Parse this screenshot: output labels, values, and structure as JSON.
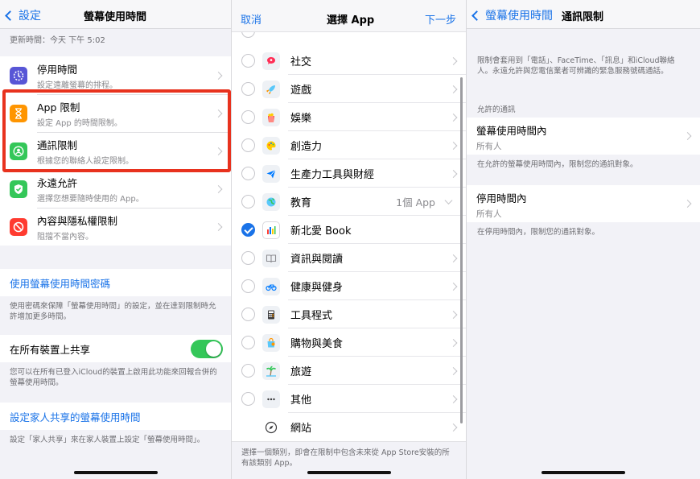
{
  "panel1": {
    "back_label": "設定",
    "title": "螢幕使用時間",
    "updated": "更新時間：今天 下午 5:02",
    "items": [
      {
        "title": "停用時間",
        "subtitle": "設定遠離螢幕的排程。",
        "icon": "downtime-icon",
        "color": "#5856d6"
      },
      {
        "title": "App 限制",
        "subtitle": "設定 App 的時間限制。",
        "icon": "hourglass-icon",
        "color": "#ff9500"
      },
      {
        "title": "通訊限制",
        "subtitle": "根據您的聯絡人設定限制。",
        "icon": "contact-icon",
        "color": "#34c759"
      },
      {
        "title": "永遠允許",
        "subtitle": "選擇您想要隨時使用的 App。",
        "icon": "checkmark-shield-icon",
        "color": "#34c759"
      },
      {
        "title": "內容與隱私權限制",
        "subtitle": "阻擋不當內容。",
        "icon": "restriction-icon",
        "color": "#ff3b30"
      }
    ],
    "passcode_link": "使用螢幕使用時間密碼",
    "passcode_note": "使用密碼來保障「螢幕使用時間」的設定，並在達到限制時允許增加更多時間。",
    "share_label": "在所有裝置上共享",
    "share_on": true,
    "share_note": "您可以在所有已登入iCloud的裝置上啟用此功能來回報合併的螢幕使用時間。",
    "family_link": "設定家人共享的螢幕使用時間",
    "family_note": "設定「家人共享」來在家人裝置上設定「螢幕使用時間」。"
  },
  "panel2": {
    "cancel_label": "取消",
    "title": "選擇 App",
    "next_label": "下一步",
    "categories": [
      {
        "label": "社交",
        "checked": false,
        "icon": "social-icon",
        "color": "#ff2d55"
      },
      {
        "label": "遊戲",
        "checked": false,
        "icon": "rocket-icon",
        "color": "#5ac8fa"
      },
      {
        "label": "娛樂",
        "checked": false,
        "icon": "popcorn-icon",
        "color": "#ff3b30"
      },
      {
        "label": "創造力",
        "checked": false,
        "icon": "palette-icon",
        "color": "#ffcc00"
      },
      {
        "label": "生產力工具與財經",
        "checked": false,
        "icon": "paperplane-icon",
        "color": "#007aff"
      },
      {
        "label": "教育",
        "checked": false,
        "icon": "globe-icon",
        "color": "#34c759",
        "count": "1個 App",
        "expanded": true
      },
      {
        "label": "新北愛 Book",
        "checked": true,
        "icon": "book-app-icon",
        "color": "#5856d6"
      },
      {
        "label": "資訊與閱讀",
        "checked": false,
        "icon": "open-book-icon",
        "color": "#8e8e93"
      },
      {
        "label": "健康與健身",
        "checked": false,
        "icon": "bicycle-icon",
        "color": "#007aff"
      },
      {
        "label": "工具程式",
        "checked": false,
        "icon": "calculator-icon",
        "color": "#8e8e93"
      },
      {
        "label": "購物與美食",
        "checked": false,
        "icon": "shopping-bag-icon",
        "color": "#ff9500"
      },
      {
        "label": "旅遊",
        "checked": false,
        "icon": "palm-tree-icon",
        "color": "#34c759"
      },
      {
        "label": "其他",
        "checked": false,
        "icon": "ellipsis-icon",
        "color": "#8e8e93"
      },
      {
        "label": "網站",
        "checked": null,
        "icon": "compass-icon",
        "color": "#3a3a3c"
      }
    ],
    "footer_note": "選擇一個類別，即會在限制中包含未來從 App Store安裝的所有該類別 App。"
  },
  "panel3": {
    "back_label": "螢幕使用時間",
    "title": "通訊限制",
    "intro": "限制會套用到「電話」、FaceTime、「訊息」和iCloud聯絡人。永遠允許與您電信業者可辨識的緊急服務號碼通話。",
    "section_header": "允許的通訊",
    "cells": [
      {
        "title": "螢幕使用時間內",
        "value": "所有人",
        "note": "在允許的螢幕使用時間內，限制您的通訊對象。"
      },
      {
        "title": "停用時間內",
        "value": "所有人",
        "note": "在停用時間內，限制您的通訊對象。"
      }
    ]
  }
}
